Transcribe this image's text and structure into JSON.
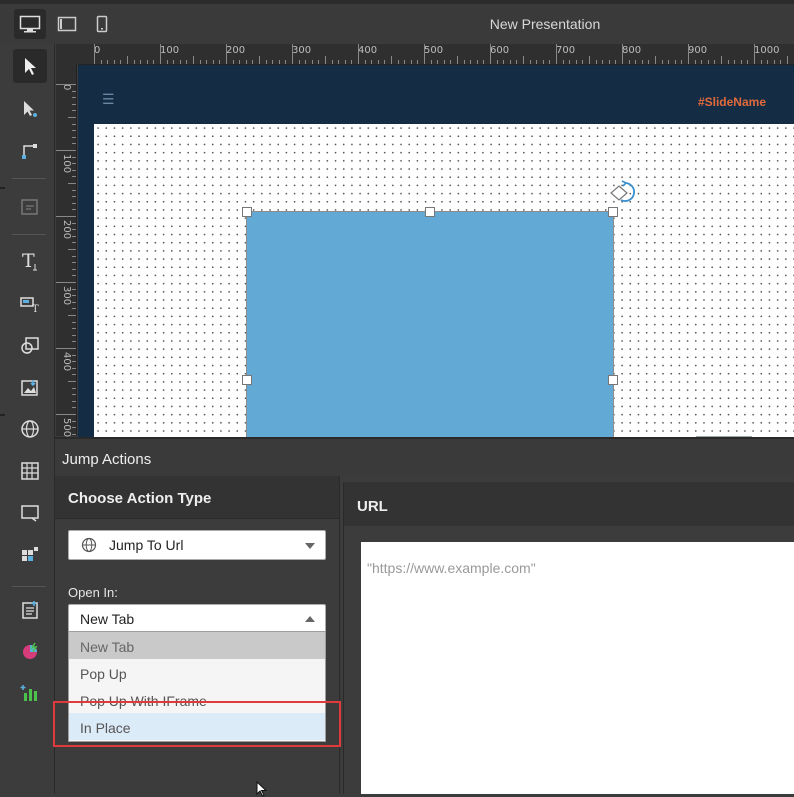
{
  "window": {
    "title": "New Presentation"
  },
  "slide": {
    "name": "#SlideName"
  },
  "ruler": {
    "horizontal": [
      "0",
      "100",
      "200",
      "300",
      "400",
      "500",
      "600",
      "700",
      "800",
      "900",
      "1000"
    ],
    "vertical": [
      "0",
      "100",
      "200",
      "300",
      "400",
      "500"
    ]
  },
  "panel": {
    "title": "Jump Actions",
    "choose_header": "Choose Action Type",
    "action_type": "Jump To Url",
    "open_in_label": "Open In:",
    "open_in_selected": "New Tab",
    "open_in_options": [
      "New Tab",
      "Pop Up",
      "Pop Up With IFrame",
      "In Place"
    ],
    "url_header": "URL",
    "url_placeholder": "\"https://www.example.com\""
  },
  "colors": {
    "accent_highlight": "#e03a3a",
    "shape_fill": "#62a9d5",
    "slide_header": "#142d45",
    "slide_name": "#e06a3c"
  }
}
